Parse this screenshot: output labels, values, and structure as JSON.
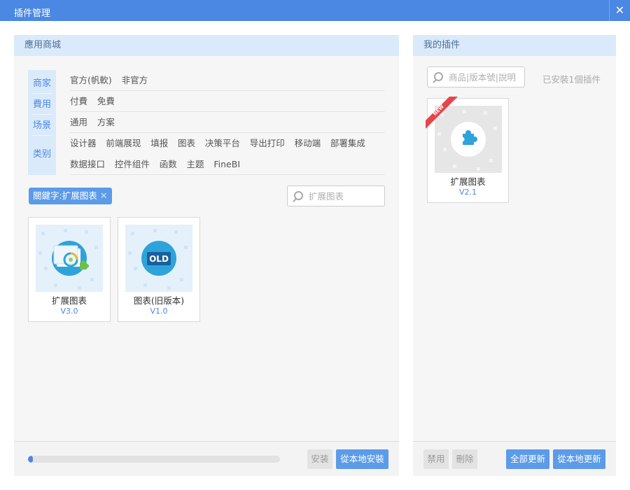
{
  "window": {
    "title": "插件管理"
  },
  "store": {
    "header": "應用商城",
    "filters": [
      {
        "category": "商家",
        "options": [
          "官方(帆軟)",
          "非官方"
        ]
      },
      {
        "category": "費用",
        "options": [
          "付費",
          "免費"
        ]
      },
      {
        "category": "场景",
        "options": [
          "通用",
          "方案"
        ]
      },
      {
        "category": "类别",
        "options": [
          "设计器",
          "前端展现",
          "填报",
          "图表",
          "决策平台",
          "导出打印",
          "移动端",
          "部署集成"
        ],
        "options2": [
          "数据接口",
          "控件组件",
          "函数",
          "主题",
          "FineBI"
        ]
      }
    ],
    "keyword_chip": "關鍵字:扩展图表",
    "search_placeholder": "扩展图表",
    "plugins": [
      {
        "name": "扩展图表",
        "version": "V3.0",
        "icon": "chart-plugin-icon"
      },
      {
        "name": "图表(旧版本)",
        "version": "V1.0",
        "icon": "old-badge-icon",
        "badge": "OLD"
      }
    ],
    "progress": 0.02,
    "install_label": "安装",
    "local_install_label": "從本地安裝"
  },
  "mine": {
    "header": "我的插件",
    "search_placeholder": "商品|版本號|說明",
    "installed_text": "已安裝1個插件",
    "plugins": [
      {
        "name": "扩展图表",
        "version": "V2.1",
        "ribbon": "NEW",
        "icon": "puzzle-icon"
      }
    ],
    "disable_label": "禁用",
    "delete_label": "刪除",
    "update_all_label": "全部更新",
    "local_update_label": "從本地更新"
  },
  "colors": {
    "accent": "#4a88e3",
    "header_bg": "#dbeafa",
    "ribbon": "#e5454b"
  }
}
